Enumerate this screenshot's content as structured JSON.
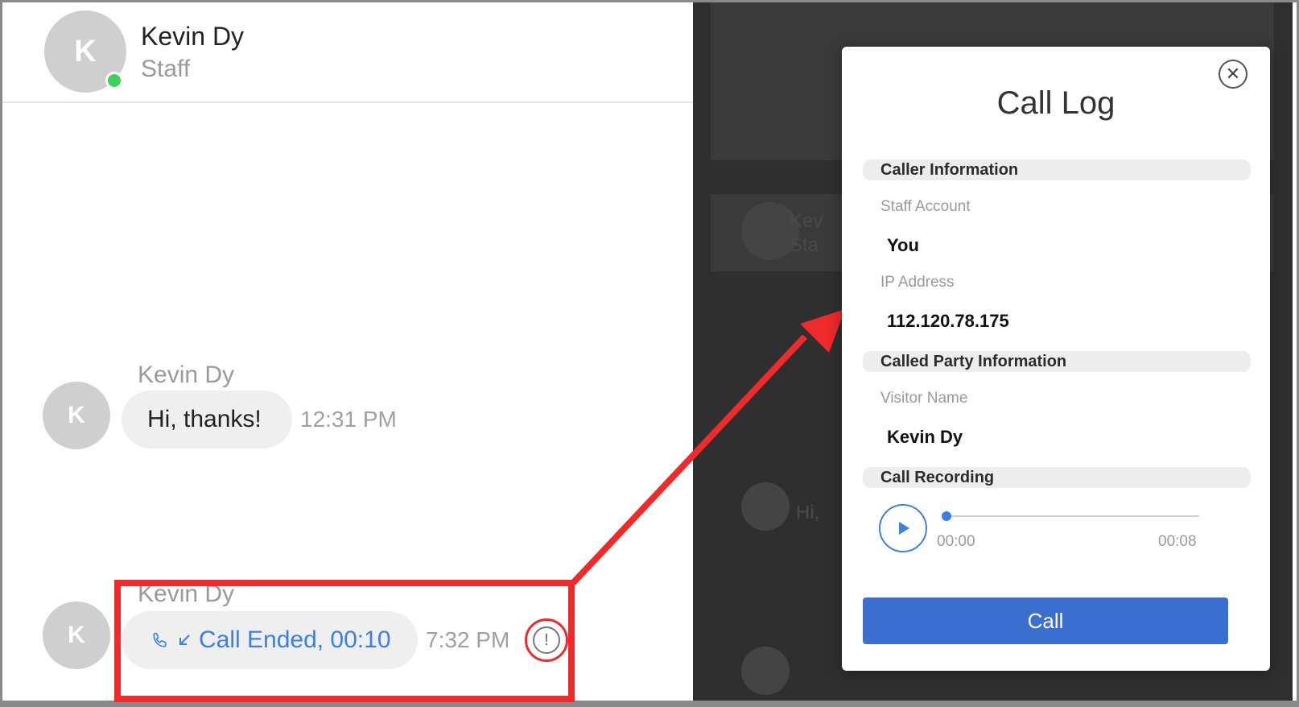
{
  "chat": {
    "header": {
      "avatar_letter": "K",
      "name": "Kevin Dy",
      "role": "Staff"
    },
    "messages": [
      {
        "sender": "Kevin Dy",
        "avatar_letter": "K",
        "text": "Hi, thanks!",
        "time": "12:31 PM"
      },
      {
        "sender": "Kevin Dy",
        "avatar_letter": "K",
        "text": "Call Ended, 00:10",
        "time": "7:32 PM"
      }
    ],
    "info_icon_glyph": "!"
  },
  "background": {
    "avatar_letter": "K",
    "ghost_name": "Kev",
    "ghost_role": "Sta",
    "ghost_msg": "Hi,"
  },
  "modal": {
    "title": "Call Log",
    "close_glyph": "✕",
    "caller_section": "Caller Information",
    "staff_account_label": "Staff Account",
    "staff_account_value": "You",
    "ip_label": "IP Address",
    "ip_value": "112.120.78.175",
    "called_section": "Called Party Information",
    "visitor_label": "Visitor Name",
    "visitor_value": "Kevin Dy",
    "recording_section": "Call Recording",
    "time_start": "00:00",
    "time_end": "00:08",
    "call_button": "Call"
  },
  "colors": {
    "accent_blue": "#3a6fd0",
    "link_blue": "#3b7fe6",
    "online_green": "#3ecf5c",
    "annotation_red": "#ee2a2a",
    "overlay_dark": "#2f2f2f"
  },
  "icons": {
    "phone": "phone-icon",
    "incoming": "incoming-arrow-icon",
    "info": "info-icon",
    "close": "close-icon",
    "play": "play-icon"
  }
}
